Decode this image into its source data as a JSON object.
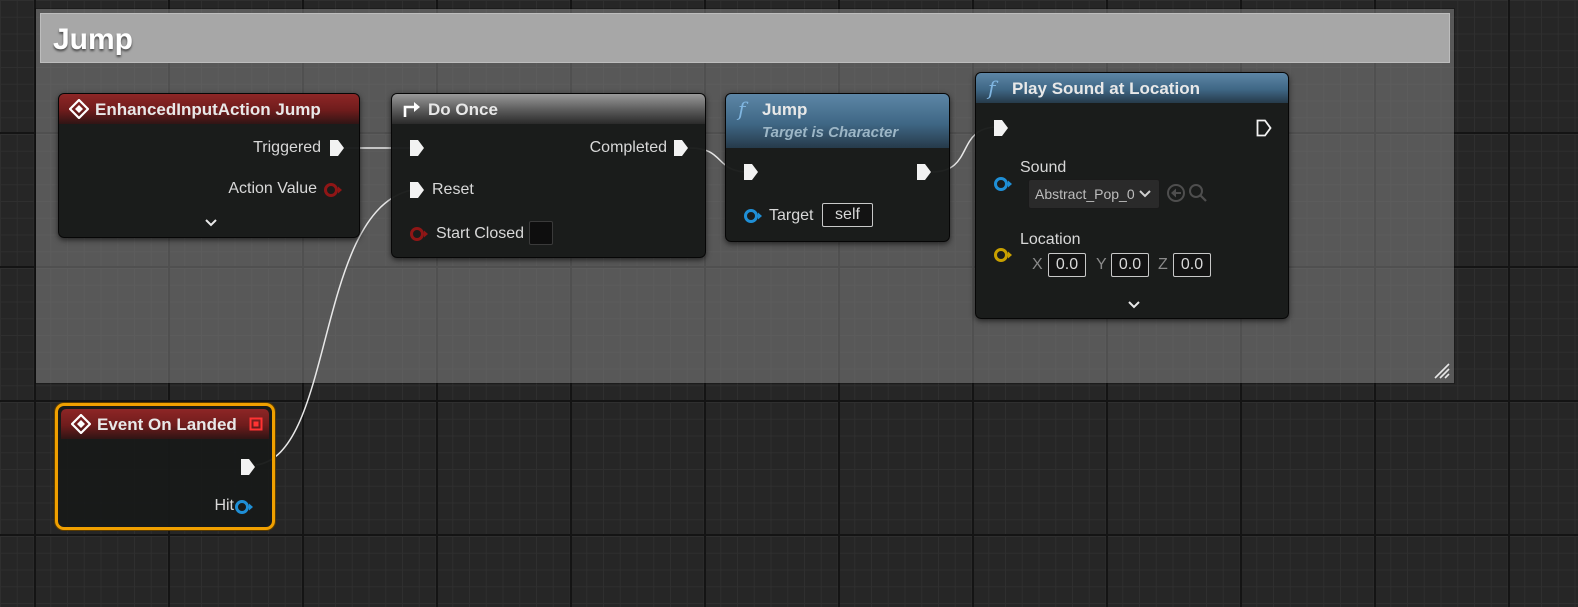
{
  "comment": {
    "title": "Jump"
  },
  "nodes": {
    "input_action": {
      "title": "EnhancedInputAction Jump",
      "pins": {
        "triggered": "Triggered",
        "action_value": "Action Value"
      }
    },
    "do_once": {
      "title": "Do Once",
      "pins": {
        "completed": "Completed",
        "reset": "Reset",
        "start_closed": "Start Closed"
      }
    },
    "jump": {
      "title": "Jump",
      "subtitle": "Target is Character",
      "pins": {
        "target": "Target"
      },
      "target_value": "self"
    },
    "play_sound": {
      "title": "Play Sound at Location",
      "pins": {
        "sound": "Sound",
        "location": "Location"
      },
      "sound_value": "Abstract_Pop_0",
      "location": {
        "x_label": "X",
        "x": "0.0",
        "y_label": "Y",
        "y": "0.0",
        "z_label": "Z",
        "z": "0.0"
      }
    },
    "on_landed": {
      "title": "Event On Landed",
      "pins": {
        "hit": "Hit"
      }
    }
  },
  "icons": {
    "event": "event-diamond-icon",
    "function": "function-icon",
    "flow": "flow-arrow-icon",
    "exec": "exec-pin-icon",
    "data": "data-pin-icon",
    "expand": "chevron-down-icon"
  },
  "colors": {
    "event_header": "#8e2626",
    "flow_header": "#9a9a9a",
    "function_header": "#5d86a6",
    "object_pin": "#1f8fd6",
    "struct_pin": "#c8a000",
    "bool_pin": "#8f1616",
    "selection": "#f0a000"
  }
}
